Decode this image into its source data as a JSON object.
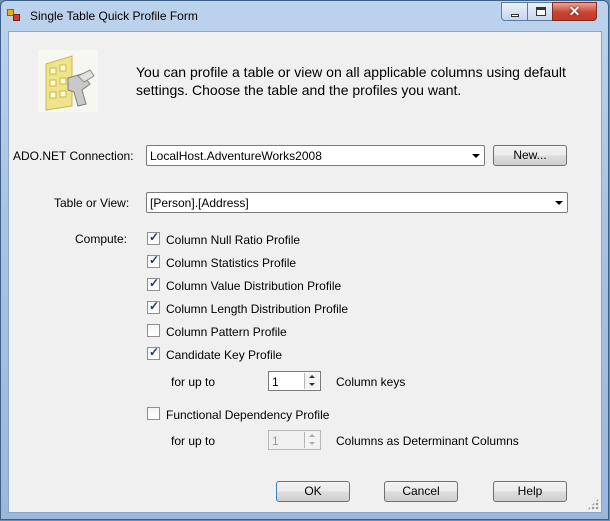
{
  "window": {
    "title": "Single Table Quick Profile Form",
    "close_glyph": "✕"
  },
  "banner": {
    "text": "You can profile a table or view on all applicable columns using default settings. Choose the table and the profiles you want."
  },
  "connection": {
    "label": "ADO.NET Connection:",
    "value": "LocalHost.AdventureWorks2008",
    "new_button": "New..."
  },
  "table": {
    "label": "Table or View:",
    "value": "[Person].[Address]"
  },
  "compute": {
    "label": "Compute:",
    "profiles": [
      {
        "label": "Column Null Ratio Profile",
        "checked": true
      },
      {
        "label": "Column Statistics Profile",
        "checked": true
      },
      {
        "label": "Column Value Distribution Profile",
        "checked": true
      },
      {
        "label": "Column Length Distribution Profile",
        "checked": true
      },
      {
        "label": "Column Pattern Profile",
        "checked": false
      },
      {
        "label": "Candidate Key Profile",
        "checked": true
      }
    ],
    "candidate_key": {
      "for_up_to": "for up to",
      "value": "1",
      "suffix": "Column keys"
    },
    "functional_dependency": {
      "label": "Functional Dependency Profile",
      "checked": false,
      "for_up_to": "for up to",
      "value": "1",
      "suffix": "Columns as Determinant Columns"
    }
  },
  "buttons": {
    "ok": "OK",
    "cancel": "Cancel",
    "help": "Help"
  },
  "colors": {
    "title_bar": "#a9c4e3",
    "close_button": "#c94330",
    "client_bg": "#f0f0f0"
  },
  "icons": [
    "form-icon",
    "profile-wizard-icon",
    "minimize-icon",
    "maximize-icon",
    "close-icon",
    "dropdown-arrow-icon",
    "checkmark-icon",
    "spin-up-icon",
    "spin-down-icon",
    "resize-grip-icon"
  ]
}
